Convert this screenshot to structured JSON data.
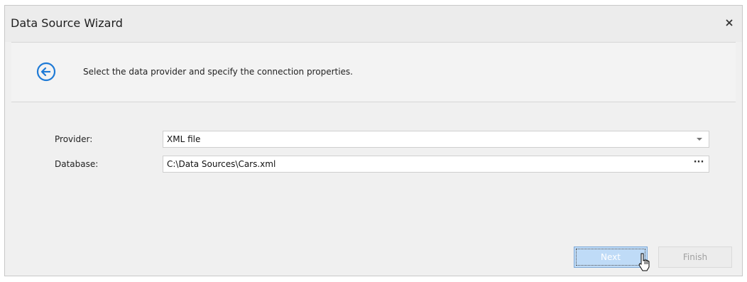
{
  "window": {
    "title": "Data Source Wizard",
    "close_symbol": "×"
  },
  "header": {
    "instruction": "Select the data provider and specify the connection properties.",
    "back_icon": "back-arrow-circle-icon"
  },
  "form": {
    "provider": {
      "label": "Provider:",
      "value": "XML file"
    },
    "database": {
      "label": "Database:",
      "value": "C:\\Data Sources\\Cars.xml",
      "browse_label": "···"
    }
  },
  "buttons": {
    "next_label": "Next",
    "finish_label": "Finish"
  },
  "colors": {
    "accent": "#1e7ad6",
    "next_bg": "#bfdbf7",
    "window_bg": "#f0f0f0"
  }
}
